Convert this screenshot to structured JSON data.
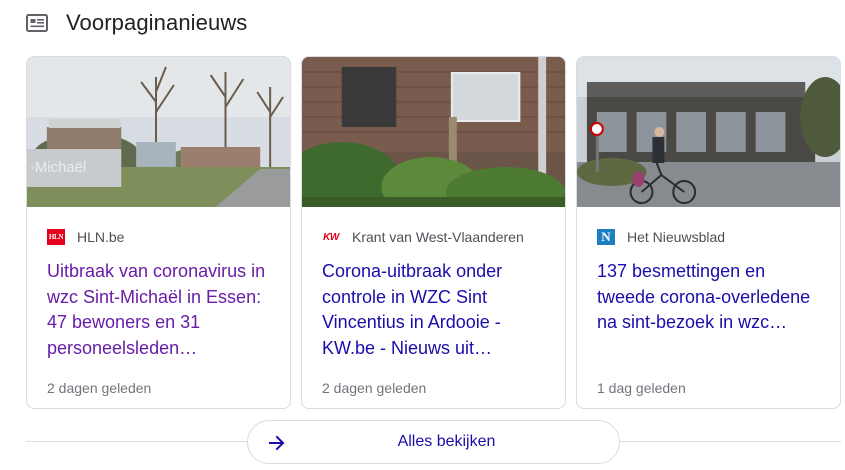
{
  "header": {
    "title": "Voorpaginanieuws",
    "icon": "newspaper-icon"
  },
  "cards": [
    {
      "source": "HLN.be",
      "favicon_text": "HLN",
      "headline": "Uitbraak van coronavirus in wzc Sint-Michaël in Essen: 47 bewoners en 31 personeelsleden…",
      "time": "2 dagen geleden",
      "image_sign_text": "-Michaël"
    },
    {
      "source": "Krant van West-Vlaanderen",
      "favicon_text": "KW",
      "headline": "Corona-uitbraak onder controle in WZC Sint Vincentius in Ardooie - KW.be - Nieuws uit…",
      "time": "2 dagen geleden"
    },
    {
      "source": "Het Nieuwsblad",
      "favicon_text": "N",
      "headline": "137 besmettingen en tweede corona-overledene na sint-bezoek in wzc…",
      "time": "1 dag geleden"
    }
  ],
  "footer": {
    "more_label": "Alles bekijken",
    "arrow_icon": "arrow-right-icon"
  },
  "colors": {
    "visited_link": "#681da8",
    "link": "#1a0dab",
    "border": "#dadce0"
  }
}
